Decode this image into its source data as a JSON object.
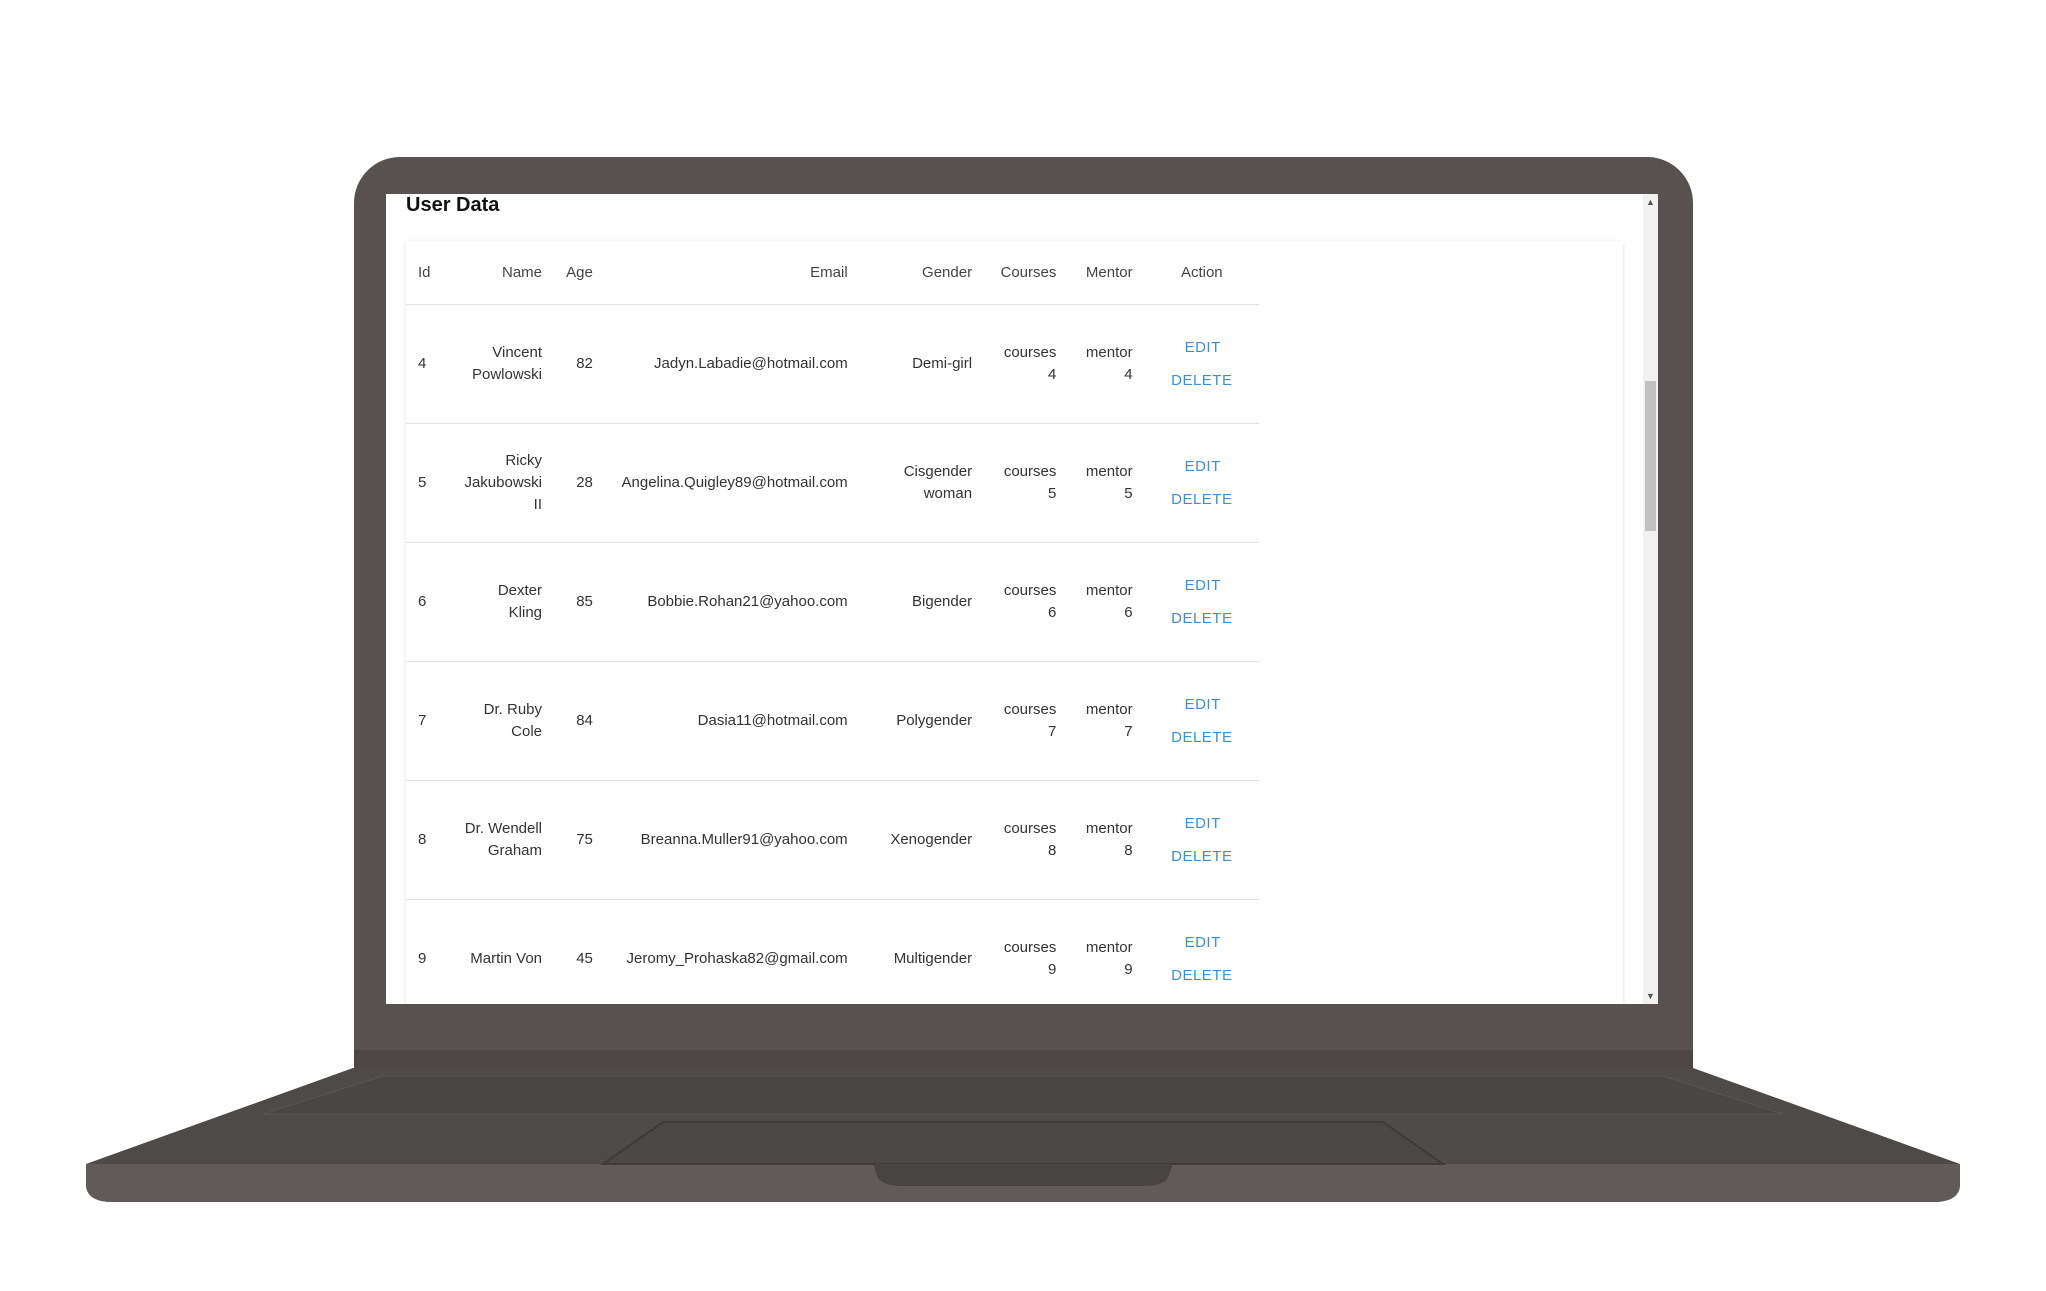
{
  "page": {
    "title": "User Data"
  },
  "table": {
    "headers": [
      "Id",
      "Name",
      "Age",
      "Email",
      "Gender",
      "Courses",
      "Mentor",
      "Action"
    ],
    "rows": [
      {
        "id": "4",
        "name": [
          "Vincent",
          "Powlowski"
        ],
        "age": "82",
        "email": "Jadyn.Labadie@hotmail.com",
        "gender": [
          "Demi-girl"
        ],
        "courses": [
          "courses",
          "4"
        ],
        "mentor": [
          "mentor",
          "4"
        ]
      },
      {
        "id": "5",
        "name": [
          "Ricky",
          "Jakubowski",
          "II"
        ],
        "age": "28",
        "email": "Angelina.Quigley89@hotmail.com",
        "gender": [
          "Cisgender",
          "woman"
        ],
        "courses": [
          "courses",
          "5"
        ],
        "mentor": [
          "mentor",
          "5"
        ]
      },
      {
        "id": "6",
        "name": [
          "Dexter",
          "Kling"
        ],
        "age": "85",
        "email": "Bobbie.Rohan21@yahoo.com",
        "gender": [
          "Bigender"
        ],
        "courses": [
          "courses",
          "6"
        ],
        "mentor": [
          "mentor",
          "6"
        ]
      },
      {
        "id": "7",
        "name": [
          "Dr. Ruby",
          "Cole"
        ],
        "age": "84",
        "email": "Dasia11@hotmail.com",
        "gender": [
          "Polygender"
        ],
        "courses": [
          "courses",
          "7"
        ],
        "mentor": [
          "mentor",
          "7"
        ]
      },
      {
        "id": "8",
        "name": [
          "Dr. Wendell",
          "Graham"
        ],
        "age": "75",
        "email": "Breanna.Muller91@yahoo.com",
        "gender": [
          "Xenogender"
        ],
        "courses": [
          "courses",
          "8"
        ],
        "mentor": [
          "mentor",
          "8"
        ]
      },
      {
        "id": "9",
        "name": [
          "Martin Von"
        ],
        "age": "45",
        "email": "Jeromy_Prohaska82@gmail.com",
        "gender": [
          "Multigender"
        ],
        "courses": [
          "courses",
          "9"
        ],
        "mentor": [
          "mentor",
          "9"
        ]
      }
    ],
    "actions": {
      "edit_label": "EDIT",
      "delete_label": "DELETE"
    }
  },
  "scrollbar": {
    "up_icon": "▲",
    "down_icon": "▼"
  },
  "colors": {
    "link": "#3b8fd8",
    "laptop": "#575250"
  }
}
